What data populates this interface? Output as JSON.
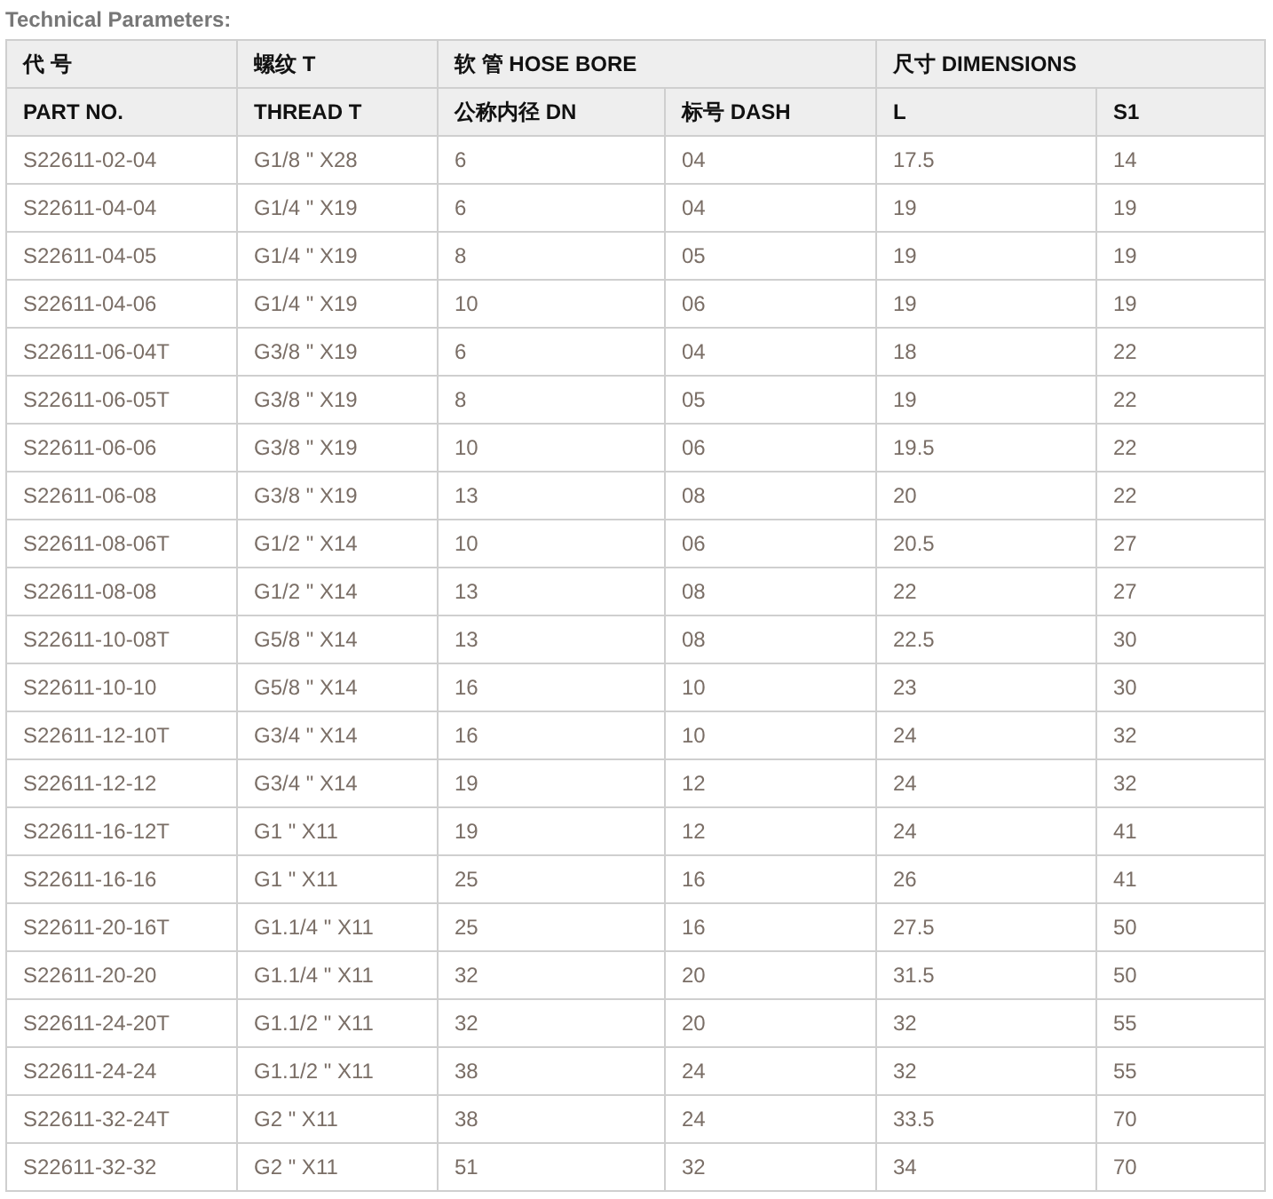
{
  "title": "Technical Parameters:",
  "table": {
    "header_groups": [
      {
        "label": "代 号",
        "columns": [
          "PART NO."
        ]
      },
      {
        "label": "螺纹 T",
        "columns": [
          "THREAD T"
        ]
      },
      {
        "label": "软 管 HOSE BORE",
        "columns": [
          "公称内径 DN",
          "标号 DASH"
        ]
      },
      {
        "label": "尺寸  DIMENSIONS",
        "columns": [
          "L",
          "S1"
        ]
      }
    ],
    "rows": [
      [
        "S22611-02-04",
        "G1/8 \" X28",
        "6",
        "04",
        "17.5",
        "14"
      ],
      [
        "S22611-04-04",
        "G1/4 \" X19",
        "6",
        "04",
        "19",
        "19"
      ],
      [
        "S22611-04-05",
        "G1/4 \" X19",
        "8",
        "05",
        "19",
        "19"
      ],
      [
        "S22611-04-06",
        "G1/4 \" X19",
        "10",
        "06",
        "19",
        "19"
      ],
      [
        "S22611-06-04T",
        "G3/8 \" X19",
        "6",
        "04",
        "18",
        "22"
      ],
      [
        "S22611-06-05T",
        "G3/8 \" X19",
        "8",
        "05",
        "19",
        "22"
      ],
      [
        "S22611-06-06",
        "G3/8 \" X19",
        "10",
        "06",
        "19.5",
        "22"
      ],
      [
        "S22611-06-08",
        "G3/8 \" X19",
        "13",
        "08",
        "20",
        "22"
      ],
      [
        "S22611-08-06T",
        "G1/2 \" X14",
        "10",
        "06",
        "20.5",
        "27"
      ],
      [
        "S22611-08-08",
        "G1/2 \" X14",
        "13",
        "08",
        "22",
        "27"
      ],
      [
        "S22611-10-08T",
        "G5/8 \" X14",
        "13",
        "08",
        "22.5",
        "30"
      ],
      [
        "S22611-10-10",
        "G5/8 \" X14",
        "16",
        "10",
        "23",
        "30"
      ],
      [
        "S22611-12-10T",
        "G3/4 \" X14",
        "16",
        "10",
        "24",
        "32"
      ],
      [
        "S22611-12-12",
        "G3/4 \" X14",
        "19",
        "12",
        "24",
        "32"
      ],
      [
        "S22611-16-12T",
        "G1 \" X11",
        "19",
        "12",
        "24",
        "41"
      ],
      [
        "S22611-16-16",
        "G1 \" X11",
        "25",
        "16",
        "26",
        "41"
      ],
      [
        "S22611-20-16T",
        "G1.1/4 \" X11",
        "25",
        "16",
        "27.5",
        "50"
      ],
      [
        "S22611-20-20",
        "G1.1/4 \" X11",
        "32",
        "20",
        "31.5",
        "50"
      ],
      [
        "S22611-24-20T",
        "G1.1/2 \" X11",
        "32",
        "20",
        "32",
        "55"
      ],
      [
        "S22611-24-24",
        "G1.1/2 \" X11",
        "38",
        "24",
        "32",
        "55"
      ],
      [
        "S22611-32-24T",
        "G2 \" X11",
        "38",
        "24",
        "33.5",
        "70"
      ],
      [
        "S22611-32-32",
        "G2 \" X11",
        "51",
        "32",
        "34",
        "70"
      ]
    ]
  }
}
